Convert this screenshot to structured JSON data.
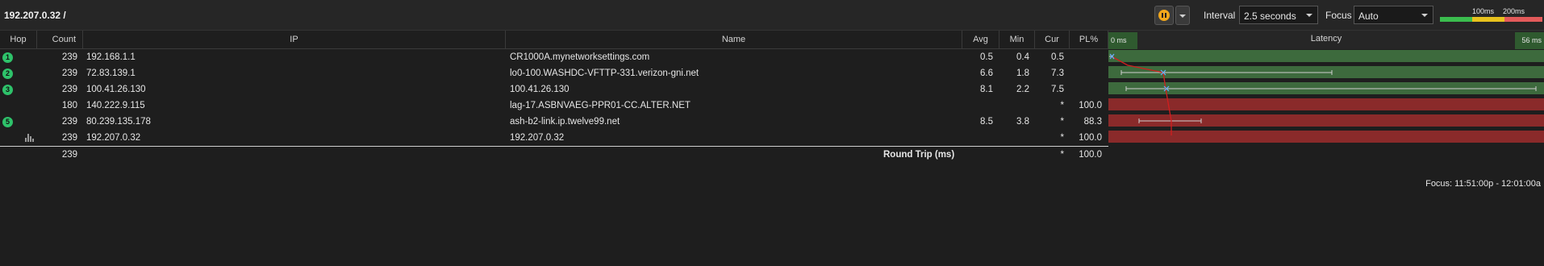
{
  "toolbar": {
    "target": "192.207.0.32 /",
    "interval_label": "Interval",
    "interval_value": "2.5 seconds",
    "focus_label": "Focus",
    "focus_value": "Auto",
    "scale": {
      "label_100": "100ms",
      "label_200": "200ms",
      "colors": [
        "#3bbd4e",
        "#e8c21d",
        "#e35a5a"
      ]
    },
    "pause_icon": "pause-icon",
    "dropdown_icon": "chevron-down-icon"
  },
  "columns": {
    "hop": "Hop",
    "count": "Count",
    "ip": "IP",
    "name": "Name",
    "avg": "Avg",
    "min": "Min",
    "cur": "Cur",
    "pl": "PL%"
  },
  "rows": [
    {
      "hop": "1",
      "count": "239",
      "ip": "192.168.1.1",
      "name": "CR1000A.mynetworksettings.com",
      "avg": "0.5",
      "min": "0.4",
      "cur": "0.5",
      "pl": ""
    },
    {
      "hop": "2",
      "count": "239",
      "ip": "72.83.139.1",
      "name": "lo0-100.WASHDC-VFTTP-331.verizon-gni.net",
      "avg": "6.6",
      "min": "1.8",
      "cur": "7.3",
      "pl": ""
    },
    {
      "hop": "3",
      "count": "239",
      "ip": "100.41.26.130",
      "name": "100.41.26.130",
      "avg": "8.1",
      "min": "2.2",
      "cur": "7.5",
      "pl": ""
    },
    {
      "hop": "",
      "count": "180",
      "ip": "140.222.9.115",
      "name": "lag-17.ASBNVAEG-PPR01-CC.ALTER.NET",
      "avg": "",
      "min": "",
      "cur": "*",
      "pl": "100.0"
    },
    {
      "hop": "5",
      "count": "239",
      "ip": "80.239.135.178",
      "name": "ash-b2-link.ip.twelve99.net",
      "avg": "8.5",
      "min": "3.8",
      "cur": "*",
      "pl": "88.3"
    },
    {
      "hop": "",
      "count": "239",
      "ip": "192.207.0.32",
      "name": "192.207.0.32",
      "avg": "",
      "min": "",
      "cur": "*",
      "pl": "100.0"
    }
  ],
  "total": {
    "count": "239",
    "label": "Round Trip (ms)",
    "cur": "*",
    "pl": "100.0"
  },
  "latency": {
    "title": "Latency",
    "min_label": "0 ms",
    "max_label": "56 ms",
    "focus_range": "Focus: 11:51:00p - 12:01:00a",
    "colors": {
      "good": "#3d6a3d",
      "loss": "#8a2a2a",
      "trace": "#d21e1e"
    }
  }
}
